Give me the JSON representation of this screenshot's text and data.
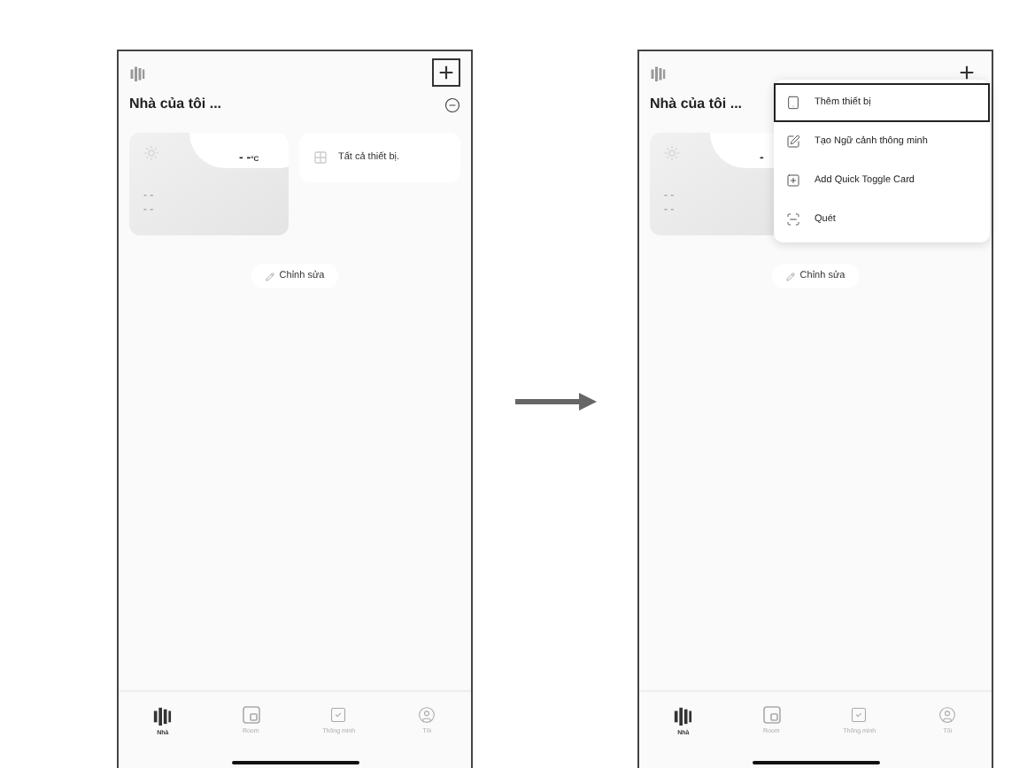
{
  "screens": [
    {
      "add_button": {
        "label": "+",
        "highlighted": true
      },
      "home_title": "Nhà của tôi ...",
      "weather": {
        "temperature": "- -",
        "unit": "°C",
        "readings": [
          "- -",
          "- -"
        ]
      },
      "all_devices": "Tất cả thiết bị.",
      "edit_button": "Chỉnh sửa",
      "tabs": [
        {
          "label": "Nhà",
          "selected": true
        },
        {
          "label": "Room",
          "selected": false
        },
        {
          "label": "Thông minh",
          "selected": false
        },
        {
          "label": "Tôi",
          "selected": false
        }
      ]
    },
    {
      "add_button": {
        "label": "+",
        "highlighted": false
      },
      "home_title": "Nhà của tôi ...",
      "weather": {
        "temperature": "-",
        "readings": [
          "- -",
          "- -"
        ]
      },
      "edit_button": "Chỉnh sửa",
      "menu": [
        {
          "kind": "add-device",
          "label": "Thêm thiết bị",
          "highlighted": true
        },
        {
          "kind": "scene",
          "label": "Tạo Ngữ cảnh thông minh",
          "highlighted": false
        },
        {
          "kind": "card",
          "label": "Add Quick Toggle Card",
          "highlighted": false
        },
        {
          "kind": "scan",
          "label": "Quét",
          "highlighted": false
        }
      ],
      "tabs": [
        {
          "label": "Nhà",
          "selected": true
        },
        {
          "label": "Room",
          "selected": false
        },
        {
          "label": "Thông minh",
          "selected": false
        },
        {
          "label": "Tôi",
          "selected": false
        }
      ]
    }
  ]
}
